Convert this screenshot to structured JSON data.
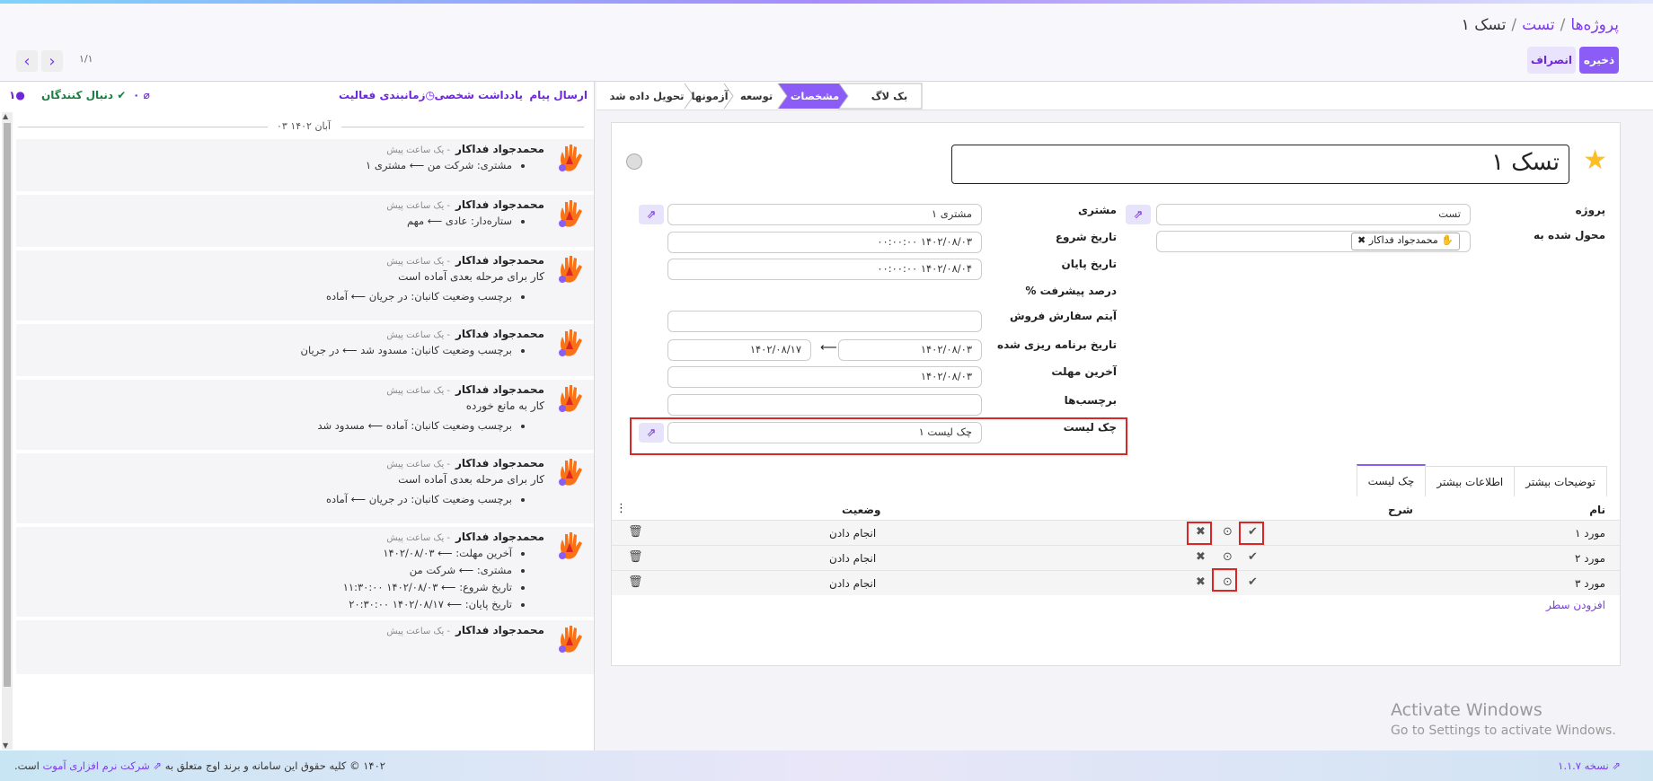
{
  "breadcrumb": {
    "root": "پروژه‌ها",
    "project": "تست",
    "current": "تسک ۱"
  },
  "actions": {
    "save": "ذخیره",
    "cancel": "انصراف"
  },
  "pager": {
    "text": "۱/۱"
  },
  "chatter": {
    "send_message": "ارسال پیام",
    "log_note": "یادداشت شخصی",
    "schedule_activity": "زمانبندی فعالیت",
    "attachments_count": "۰",
    "follow": "دنبال کنندگان",
    "followers_count": "۱",
    "date_separator": "۰۳ آبان ۱۴۰۲",
    "messages": [
      {
        "author": "محمدجواد فداکار",
        "time": "- یک ساعت پیش",
        "body": "",
        "changes": [
          "مشتری: شرکت من ⟵ مشتری ۱"
        ]
      },
      {
        "author": "محمدجواد فداکار",
        "time": "- یک ساعت پیش",
        "body": "",
        "changes": [
          "ستاره‌دار: عادی ⟵ مهم"
        ]
      },
      {
        "author": "محمدجواد فداکار",
        "time": "- یک ساعت پیش",
        "body": "کار برای مرحله بعدی آماده است",
        "changes": [
          "برچسب وضعیت کانبان: در جریان ⟵ آماده"
        ]
      },
      {
        "author": "محمدجواد فداکار",
        "time": "- یک ساعت پیش",
        "body": "",
        "changes": [
          "برچسب وضعیت کانبان: مسدود شد ⟵ در جریان"
        ]
      },
      {
        "author": "محمدجواد فداکار",
        "time": "- یک ساعت پیش",
        "body": "کار به مانع خورده",
        "changes": [
          "برچسب وضعیت کانبان: آماده ⟵ مسدود شد"
        ]
      },
      {
        "author": "محمدجواد فداکار",
        "time": "- یک ساعت پیش",
        "body": "کار برای مرحله بعدی آماده است",
        "changes": [
          "برچسب وضعیت کانبان: در جریان ⟵ آماده"
        ]
      },
      {
        "author": "محمدجواد فداکار",
        "time": "- یک ساعت پیش",
        "body": "",
        "changes": [
          "آخرین مهلت: ⟵ ۱۴۰۲/۰۸/۰۳",
          "مشتری: ⟵ شرکت من",
          "تاریخ شروع: ⟵ ۱۴۰۲/۰۸/۰۳ ۱۱:۳۰:۰۰",
          "تاریخ پایان: ⟵ ۱۴۰۲/۰۸/۱۷ ۲۰:۳۰:۰۰"
        ]
      },
      {
        "author": "محمدجواد فداکار",
        "time": "- یک ساعت پیش",
        "body": "",
        "changes": []
      }
    ]
  },
  "stages": [
    "بک لاگ",
    "مشخصات",
    "توسعه",
    "آزمونها",
    "تحویل داده شد"
  ],
  "form": {
    "title": "تسک ۱",
    "project_label": "پروژه",
    "project_value": "تست",
    "assigned_label": "محول شده به",
    "assigned_value": "محمدجواد فداکار",
    "customer_label": "مشتری",
    "customer_value": "مشتری ۱",
    "start_label": "تاریخ شروع",
    "start_value": "۱۴۰۲/۰۸/۰۳ ۰۰:۰۰:۰۰",
    "end_label": "تاریخ پایان",
    "end_value": "۱۴۰۲/۰۸/۰۴ ۰۰:۰۰:۰۰",
    "progress_label": "درصد پیشرفت %",
    "sale_item_label": "آیتم سفارش فروش",
    "planned_label": "تاریخ برنامه ریزی شده",
    "planned_from": "۱۴۰۲/۰۸/۰۳",
    "planned_to": "۱۴۰۲/۰۸/۱۷",
    "deadline_label": "آخرین مهلت",
    "deadline_value": "۱۴۰۲/۰۸/۰۳",
    "tags_label": "برچسب‌ها",
    "checklist_label": "چک لیست",
    "checklist_value": "چک لیست ۱"
  },
  "notebook": {
    "tabs": [
      "توضیحات بیشتر",
      "اطلاعات بیشتر",
      "چک لیست"
    ],
    "active": "چک لیست"
  },
  "checklist_table": {
    "headers": {
      "name": "نام",
      "description": "شرح",
      "status": "وضعیت"
    },
    "rows": [
      {
        "name": "مورد ۱",
        "status": "انجام دادن"
      },
      {
        "name": "مورد ۲",
        "status": "انجام دادن"
      },
      {
        "name": "مورد ۳",
        "status": "انجام دادن"
      }
    ],
    "add_line": "افزودن سطر"
  },
  "watermark": {
    "line1": "Activate Windows",
    "line2": "Go to Settings to activate Windows."
  },
  "footer": {
    "copyright": "۱۴۰۲ © کلیه حقوق این سامانه و برند اوج متعلق به",
    "company": "شرکت نرم افزاری آموت",
    "tail": "است.",
    "version": "نسخه ۱.۱.۷"
  }
}
